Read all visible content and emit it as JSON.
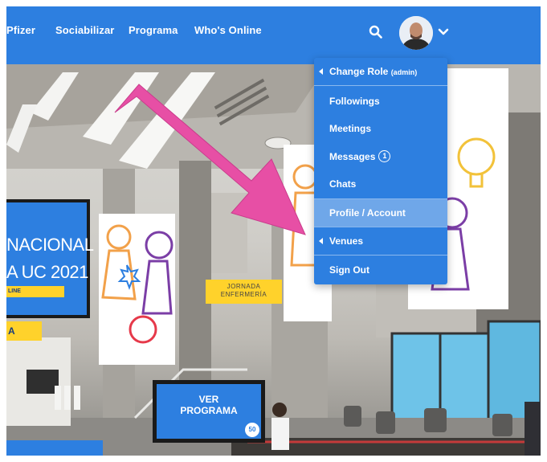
{
  "nav": {
    "items": [
      {
        "label": "Pfizer"
      },
      {
        "label": "Sociabilizar"
      },
      {
        "label": "Programa"
      },
      {
        "label": "Who's Online"
      }
    ],
    "search_icon": "search-icon",
    "avatar": "user-avatar",
    "dropdown_icon": "chevron-down-icon",
    "bar_color": "#2d7fe0"
  },
  "user_menu": {
    "items": [
      {
        "label": "Change Role",
        "suffix": "(admin)",
        "submenu": true
      },
      {
        "label": "Followings"
      },
      {
        "label": "Meetings"
      },
      {
        "label": "Messages",
        "count": "1"
      },
      {
        "label": "Chats"
      },
      {
        "label": "Profile / Account",
        "highlighted": true
      },
      {
        "label": "Venues",
        "submenu": true
      },
      {
        "label": "Sign Out"
      }
    ],
    "bg_color": "#2d7fe0",
    "highlight_color": "#6fa7e9"
  },
  "scene": {
    "left_banner": {
      "line1": "NACIONAL",
      "line2": "A UC 2021",
      "tag": "LINE",
      "lower_tag": "A"
    },
    "jornada_sign": {
      "line1": "JORNADA",
      "line2": "ENFERMERÍA"
    },
    "ver_button": {
      "line1": "VER",
      "line2": "PROGRAMA",
      "badge": "50"
    }
  }
}
